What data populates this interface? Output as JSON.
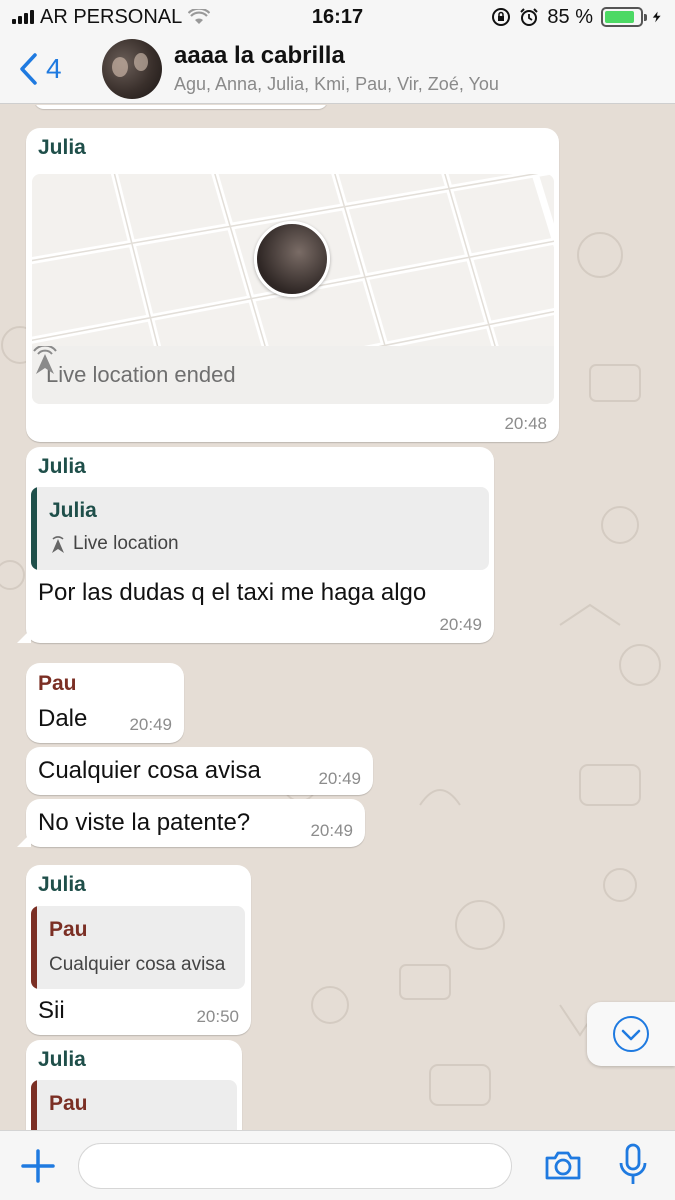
{
  "status_bar": {
    "carrier": "AR PERSONAL",
    "time": "16:17",
    "battery": "85 %",
    "battery_level": 0.85
  },
  "header": {
    "back_count": "4",
    "title": "aaaa la cabrilla",
    "members": "Agu, Anna, Julia, Kmi, Pau, Vir, Zoé, You"
  },
  "messages": [
    {
      "sender": "Julia",
      "type": "live-location",
      "location_text": "Live location ended",
      "time": "20:48"
    },
    {
      "sender": "Julia",
      "type": "reply",
      "quote_sender": "Julia",
      "quote_text": "Live location",
      "text": "Por las dudas q el taxi me haga algo",
      "time": "20:49"
    },
    {
      "sender": "Pau",
      "text": "Dale",
      "time": "20:49"
    },
    {
      "text": "Cualquier cosa avisa",
      "time": "20:49"
    },
    {
      "text": "No viste la patente?",
      "time": "20:49"
    },
    {
      "sender": "Julia",
      "type": "reply",
      "quote_sender": "Pau",
      "quote_text": "Cualquier cosa avisa",
      "text": "Sii",
      "time": "20:50"
    },
    {
      "sender": "Julia",
      "type": "reply",
      "quote_sender": "Pau"
    }
  ],
  "input": {
    "placeholder": ""
  },
  "colors": {
    "accent": "#1f7ae0",
    "julia": "#1f4f4a",
    "pau": "#7b2f24",
    "chat_bg": "#e5ddd5"
  }
}
